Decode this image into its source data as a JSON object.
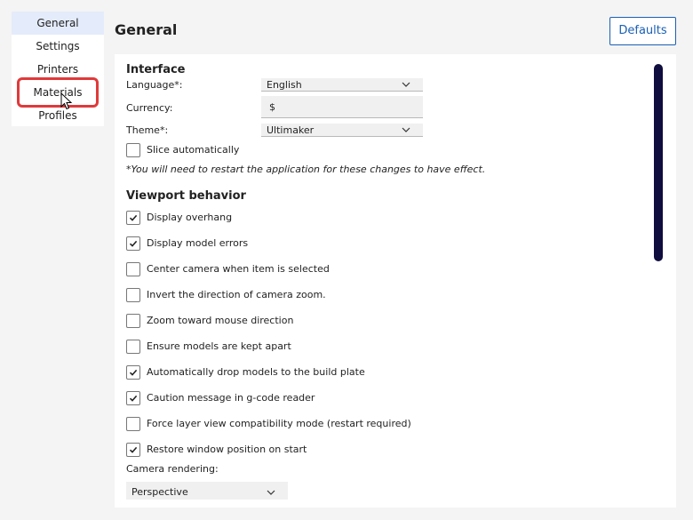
{
  "sidebar": {
    "items": [
      {
        "label": "General"
      },
      {
        "label": "Settings"
      },
      {
        "label": "Printers"
      },
      {
        "label": "Materials"
      },
      {
        "label": "Profiles"
      }
    ]
  },
  "header": {
    "title": "General",
    "defaults_label": "Defaults"
  },
  "interface": {
    "title": "Interface",
    "language_label": "Language*:",
    "language_value": "English",
    "currency_label": "Currency:",
    "currency_value": "$",
    "theme_label": "Theme*:",
    "theme_value": "Ultimaker",
    "slice_auto_label": "Slice automatically",
    "slice_auto_checked": false,
    "restart_note": "*You will need to restart the application for these changes to have effect."
  },
  "viewport": {
    "title": "Viewport behavior",
    "options": [
      {
        "label": "Display overhang",
        "checked": true
      },
      {
        "label": "Display model errors",
        "checked": true
      },
      {
        "label": "Center camera when item is selected",
        "checked": false
      },
      {
        "label": "Invert the direction of camera zoom.",
        "checked": false
      },
      {
        "label": "Zoom toward mouse direction",
        "checked": false
      },
      {
        "label": "Ensure models are kept apart",
        "checked": false
      },
      {
        "label": "Automatically drop models to the build plate",
        "checked": true
      },
      {
        "label": "Caution message in g-code reader",
        "checked": true
      },
      {
        "label": "Force layer view compatibility mode (restart required)",
        "checked": false
      },
      {
        "label": "Restore window position on start",
        "checked": true
      }
    ],
    "camera_label": "Camera rendering:",
    "camera_value": "Perspective"
  },
  "colors": {
    "accent": "#1a5fb4",
    "highlight": "#e0393a",
    "scrollbar": "#0f0e3f",
    "selected_bg": "#e4ecfb"
  }
}
